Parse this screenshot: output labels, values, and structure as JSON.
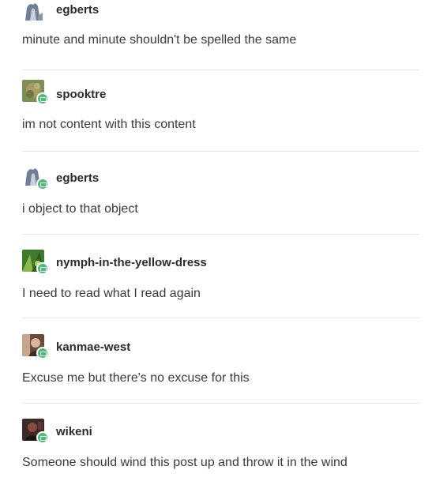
{
  "posts": [
    {
      "username": "egberts",
      "text": "minute and minute shouldn't be spelled the same",
      "avatar_icon": "ghost-figure-avatar-icon",
      "colors": {
        "a": "#6f7f96",
        "b": "#c9d0db"
      }
    },
    {
      "username": "spooktre",
      "text": "im not content with this content",
      "avatar_icon": "mossy-stone-avatar-icon",
      "colors": {
        "a": "#7c8f57",
        "b": "#a89b63"
      }
    },
    {
      "username": "egberts",
      "text": "i object to that object",
      "avatar_icon": "ghost-figure-avatar-icon",
      "colors": {
        "a": "#6f7f96",
        "b": "#c9d0db"
      }
    },
    {
      "username": "nymph-in-the-yellow-dress",
      "text": "I need to read what I read again",
      "avatar_icon": "green-foliage-avatar-icon",
      "colors": {
        "a": "#3f7a2c",
        "b": "#8bb84d"
      }
    },
    {
      "username": "kanmae-west",
      "text": "Excuse me but there's no excuse for this",
      "avatar_icon": "portrait-avatar-icon",
      "colors": {
        "a": "#6b4a3a",
        "b": "#c7a48a"
      }
    },
    {
      "username": "wikeni",
      "text": "Someone should wind this post up and throw it in the wind",
      "avatar_icon": "dark-figure-avatar-icon",
      "colors": {
        "a": "#3b2a27",
        "b": "#8a4a3c"
      }
    }
  ],
  "badge_color": "#4fb97a"
}
